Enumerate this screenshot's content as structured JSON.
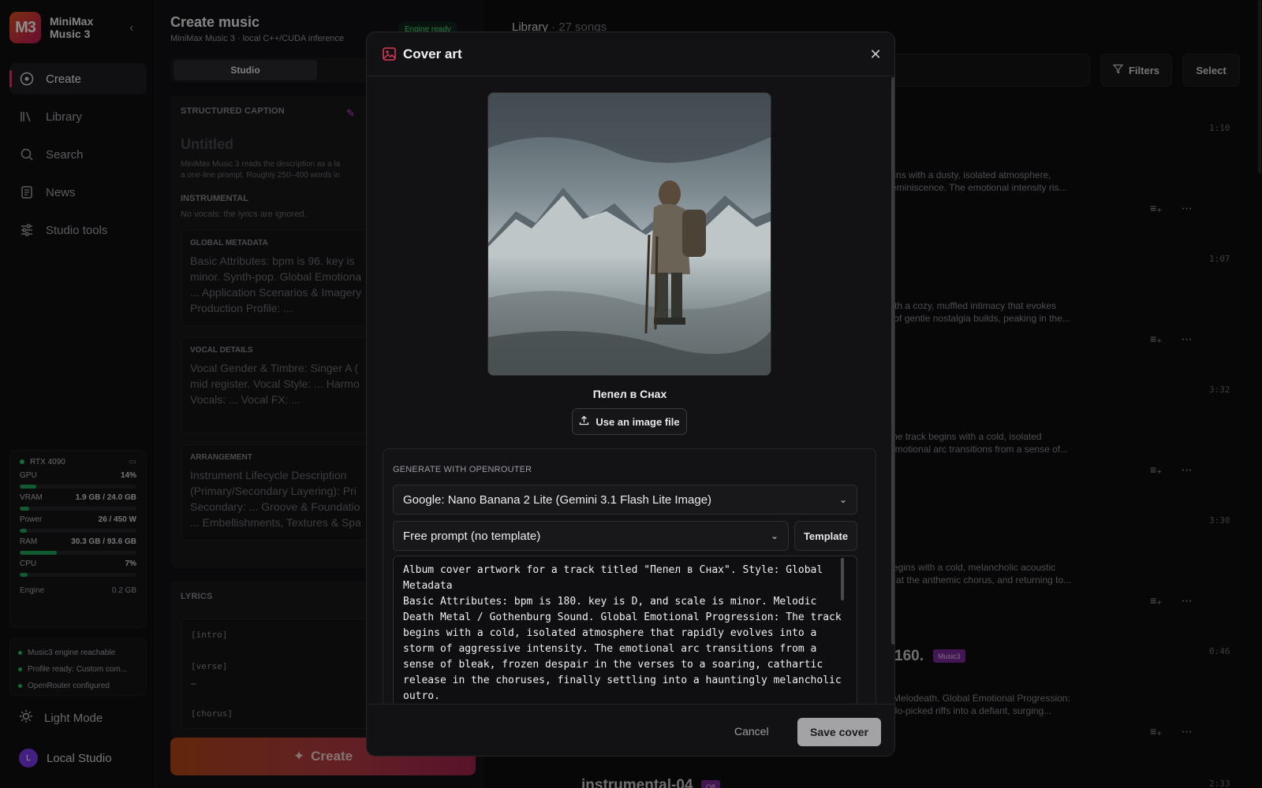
{
  "app": {
    "logo_text": "M3",
    "name_line1": "MiniMax",
    "name_line2": "Music 3"
  },
  "nav": [
    {
      "label": "Create",
      "icon": "target-icon",
      "active": true
    },
    {
      "label": "Library",
      "icon": "library-icon"
    },
    {
      "label": "Search",
      "icon": "search-icon"
    },
    {
      "label": "News",
      "icon": "news-icon"
    },
    {
      "label": "Studio tools",
      "icon": "sliders-icon"
    }
  ],
  "gpu": {
    "name": "RTX 4090",
    "metrics": [
      {
        "label": "GPU",
        "value": "14%",
        "fill": 0.14
      },
      {
        "label": "VRAM",
        "value": "1.9 GB / 24.0 GB",
        "fill": 0.08
      },
      {
        "label": "Power",
        "value": "26 / 450 W",
        "fill": 0.06
      },
      {
        "label": "RAM",
        "value": "30.3 GB / 93.6 GB",
        "fill": 0.32
      },
      {
        "label": "CPU",
        "value": "7%",
        "fill": 0.07
      }
    ],
    "engine_label": "Engine",
    "engine_value": "0.2 GB"
  },
  "status": [
    "Music3 engine reachable",
    "Profile ready: Custom com...",
    "OpenRouter configured"
  ],
  "light_mode": "Light Mode",
  "user": {
    "initial": "L",
    "name": "Local Studio"
  },
  "create": {
    "title": "Create music",
    "subtitle": "MiniMax Music 3 · local C++/CUDA inference",
    "engine_badge": "Engine ready",
    "tab": "Studio",
    "caption_label": "STRUCTURED CAPTION",
    "untitled": "Untitled",
    "hint": "MiniMax Music 3 reads the description as a la\na one-line prompt. Roughly 250–400 words in",
    "instrumental_label": "INSTRUMENTAL",
    "instrumental_sub": "No vocals: the lyrics are ignored.",
    "blocks": [
      {
        "label": "GLOBAL METADATA",
        "text": "Basic Attributes: bpm is 96. key is\nminor. Synth-pop. Global Emotiona\n... Application Scenarios & Imagery\nProduction Profile: ..."
      },
      {
        "label": "VOCAL DETAILS",
        "text": "Vocal Gender & Timbre: Singer A (\nmid register. Vocal Style: ... Harmo\nVocals: ... Vocal FX: ..."
      },
      {
        "label": "ARRANGEMENT",
        "text": "Instrument Lifecycle Description\n(Primary/Secondary Layering): Pri\nSecondary: ... Groove & Foundatio\n... Embellishments, Textures & Spa"
      }
    ],
    "lyrics_label": "LYRICS",
    "lyrics": "[intro]\n\n[verse]\n…\n\n[chorus]",
    "create_button": "Create"
  },
  "library": {
    "title": "Library",
    "count": "27 songs",
    "filters": "Filters",
    "select": "Select",
    "songs": [
      {
        "duration": "1:10",
        "desc1": "k begins with a dusty, isolated atmosphere,",
        "desc2": "azy reminiscence. The emotional intensity ris..."
      },
      {
        "duration": "1:07",
        "desc1": "ins with a cozy, muffled intimacy that evokes",
        "desc2": "ense of gentle nostalgia builds, peaking in the..."
      },
      {
        "duration": "3:32",
        "desc1": "on: The track begins with a cold, isolated",
        "desc2": "The emotional arc transitions from a sense of..."
      },
      {
        "duration": "3:30",
        "desc1": "on: Begins with a cold, melancholic acoustic",
        "desc2": "aking at the anthemic chorus, and returning to..."
      },
      {
        "duration": "0:46",
        "desc1": "style Melodeath. Global Emotional Progression:",
        "desc2": "tremolo-picked riffs into a defiant, surging..."
      }
    ],
    "partial_title": "160.",
    "partial_tag": "Music3",
    "next_title": "instrumental-04",
    "next_tag": "Q8",
    "next_duration": "2:33"
  },
  "modal": {
    "title": "Cover art",
    "song_name": "Пепел в Снах",
    "use_file": "Use an image file",
    "generate_label": "GENERATE WITH OPENROUTER",
    "model": "Google: Nano Banana 2 Lite (Gemini 3.1 Flash Lite Image)",
    "template_select": "Free prompt (no template)",
    "template_button": "Template",
    "prompt": "Album cover artwork for a track titled \"Пепел в Снах\". Style: Global Metadata\nBasic Attributes: bpm is 180. key is D, and scale is minor. Melodic Death Metal / Gothenburg Sound. Global Emotional Progression: The track begins with a cold, isolated atmosphere that rapidly evolves into a storm of aggressive intensity. The emotional arc transitions from a sense of bleak, frozen despair in the verses to a soaring, cathartic release in the choruses, finally settling into a hauntingly melancholic outro.\nApplication Scenarios & Imagery: Cinematic dark fantasy sequences,",
    "cancel": "Cancel",
    "save": "Save cover"
  }
}
